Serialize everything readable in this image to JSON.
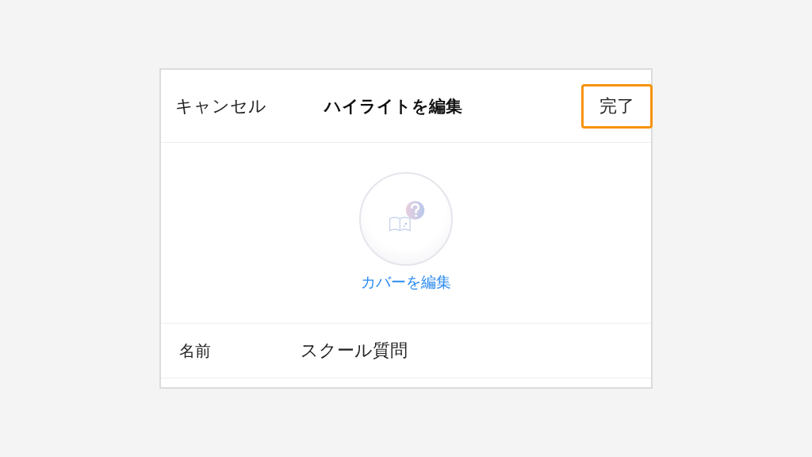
{
  "header": {
    "cancel": "キャンセル",
    "title": "ハイライトを編集",
    "done": {
      "label": "完了",
      "highlighted": true
    }
  },
  "cover": {
    "edit_link": "カバーを編集"
  },
  "fields": [
    {
      "label": "名前",
      "value": "スクール質問"
    }
  ]
}
